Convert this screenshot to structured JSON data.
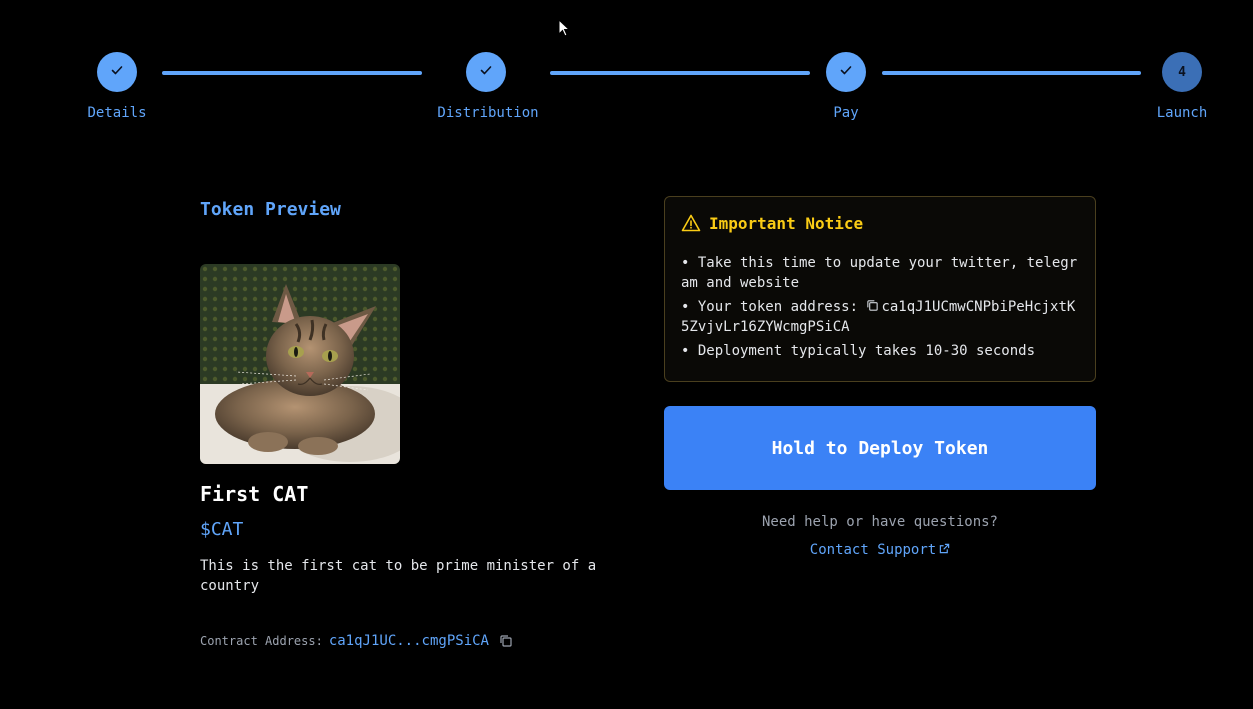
{
  "stepper": {
    "steps": [
      {
        "label": "Details",
        "state": "complete",
        "icon": "check-icon"
      },
      {
        "label": "Distribution",
        "state": "complete",
        "icon": "check-icon"
      },
      {
        "label": "Pay",
        "state": "complete",
        "icon": "check-icon"
      },
      {
        "label": "Launch",
        "state": "current",
        "number": "4"
      }
    ]
  },
  "preview": {
    "title": "Token Preview",
    "image": "cat-photo",
    "name": "First CAT",
    "symbol": "$CAT",
    "description": "This is the first cat to be prime minister of a country",
    "contract_label": "Contract Address:",
    "contract_value": "ca1qJ1UC...cmgPSiCA"
  },
  "notice": {
    "title": "Important Notice",
    "items": [
      "• Take this time to update your twitter, telegram and website",
      "• Your token address: ",
      "• Deployment typically takes 10-30 seconds"
    ],
    "token_address": "ca1qJ1UCmwCNPbiPeHcjxtK5ZvjvLr16ZYWcmgPSiCA"
  },
  "actions": {
    "deploy_label": "Hold to Deploy Token",
    "help_text": "Need help or have questions?",
    "support_label": "Contact Support"
  },
  "colors": {
    "accent": "#60a5fa",
    "button": "#3b82f6",
    "warning": "#facc15",
    "background": "#000000"
  }
}
